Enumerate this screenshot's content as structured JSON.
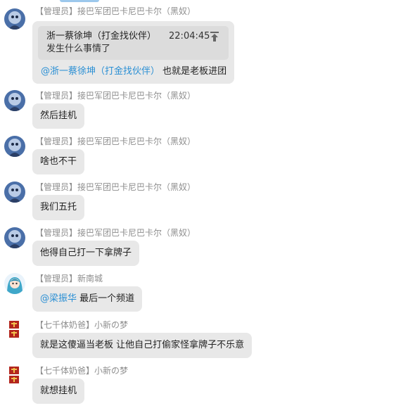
{
  "messages": [
    {
      "sender": "【管理员】接巴军团巴卡尼巴卡尔（黑奴）",
      "avatar": "blue-mask-avatar",
      "quote": {
        "author": "浙一蔡徐坤（打金找伙伴）",
        "time": "22:04:45",
        "text": "发生什么事情了"
      },
      "mention": "@浙一蔡徐坤（打金找伙伴）",
      "text": "也就是老板进团"
    },
    {
      "sender": "【管理员】接巴军团巴卡尼巴卡尔（黑奴）",
      "avatar": "blue-mask-avatar",
      "text": "然后挂机"
    },
    {
      "sender": "【管理员】接巴军团巴卡尼巴卡尔（黑奴）",
      "avatar": "blue-mask-avatar",
      "text": "啥也不干"
    },
    {
      "sender": "【管理员】接巴军团巴卡尼巴卡尔（黑奴）",
      "avatar": "blue-mask-avatar",
      "text": "我们五托"
    },
    {
      "sender": "【管理员】接巴军团巴卡尼巴卡尔（黑奴）",
      "avatar": "blue-mask-avatar",
      "text": "他得自己打一下拿牌子"
    },
    {
      "sender": "【管理员】新南城",
      "avatar": "anime-girl-avatar",
      "mention": "@梁振华",
      "text": "最后一个频道"
    },
    {
      "sender": "【七千体奶爸】小新の梦",
      "avatar": "red-calligraphy-avatar",
      "text": "就是这傻逼当老板 让他自己打偷家怪拿牌子不乐意"
    },
    {
      "sender": "【七千体奶爸】小新の梦",
      "avatar": "red-calligraphy-avatar",
      "text": "就想挂机"
    }
  ],
  "colors": {
    "bubble": "#e8e8e8",
    "quote": "#dcdcdc",
    "mention": "#2a8fd4",
    "sender": "#8e8e8e"
  }
}
